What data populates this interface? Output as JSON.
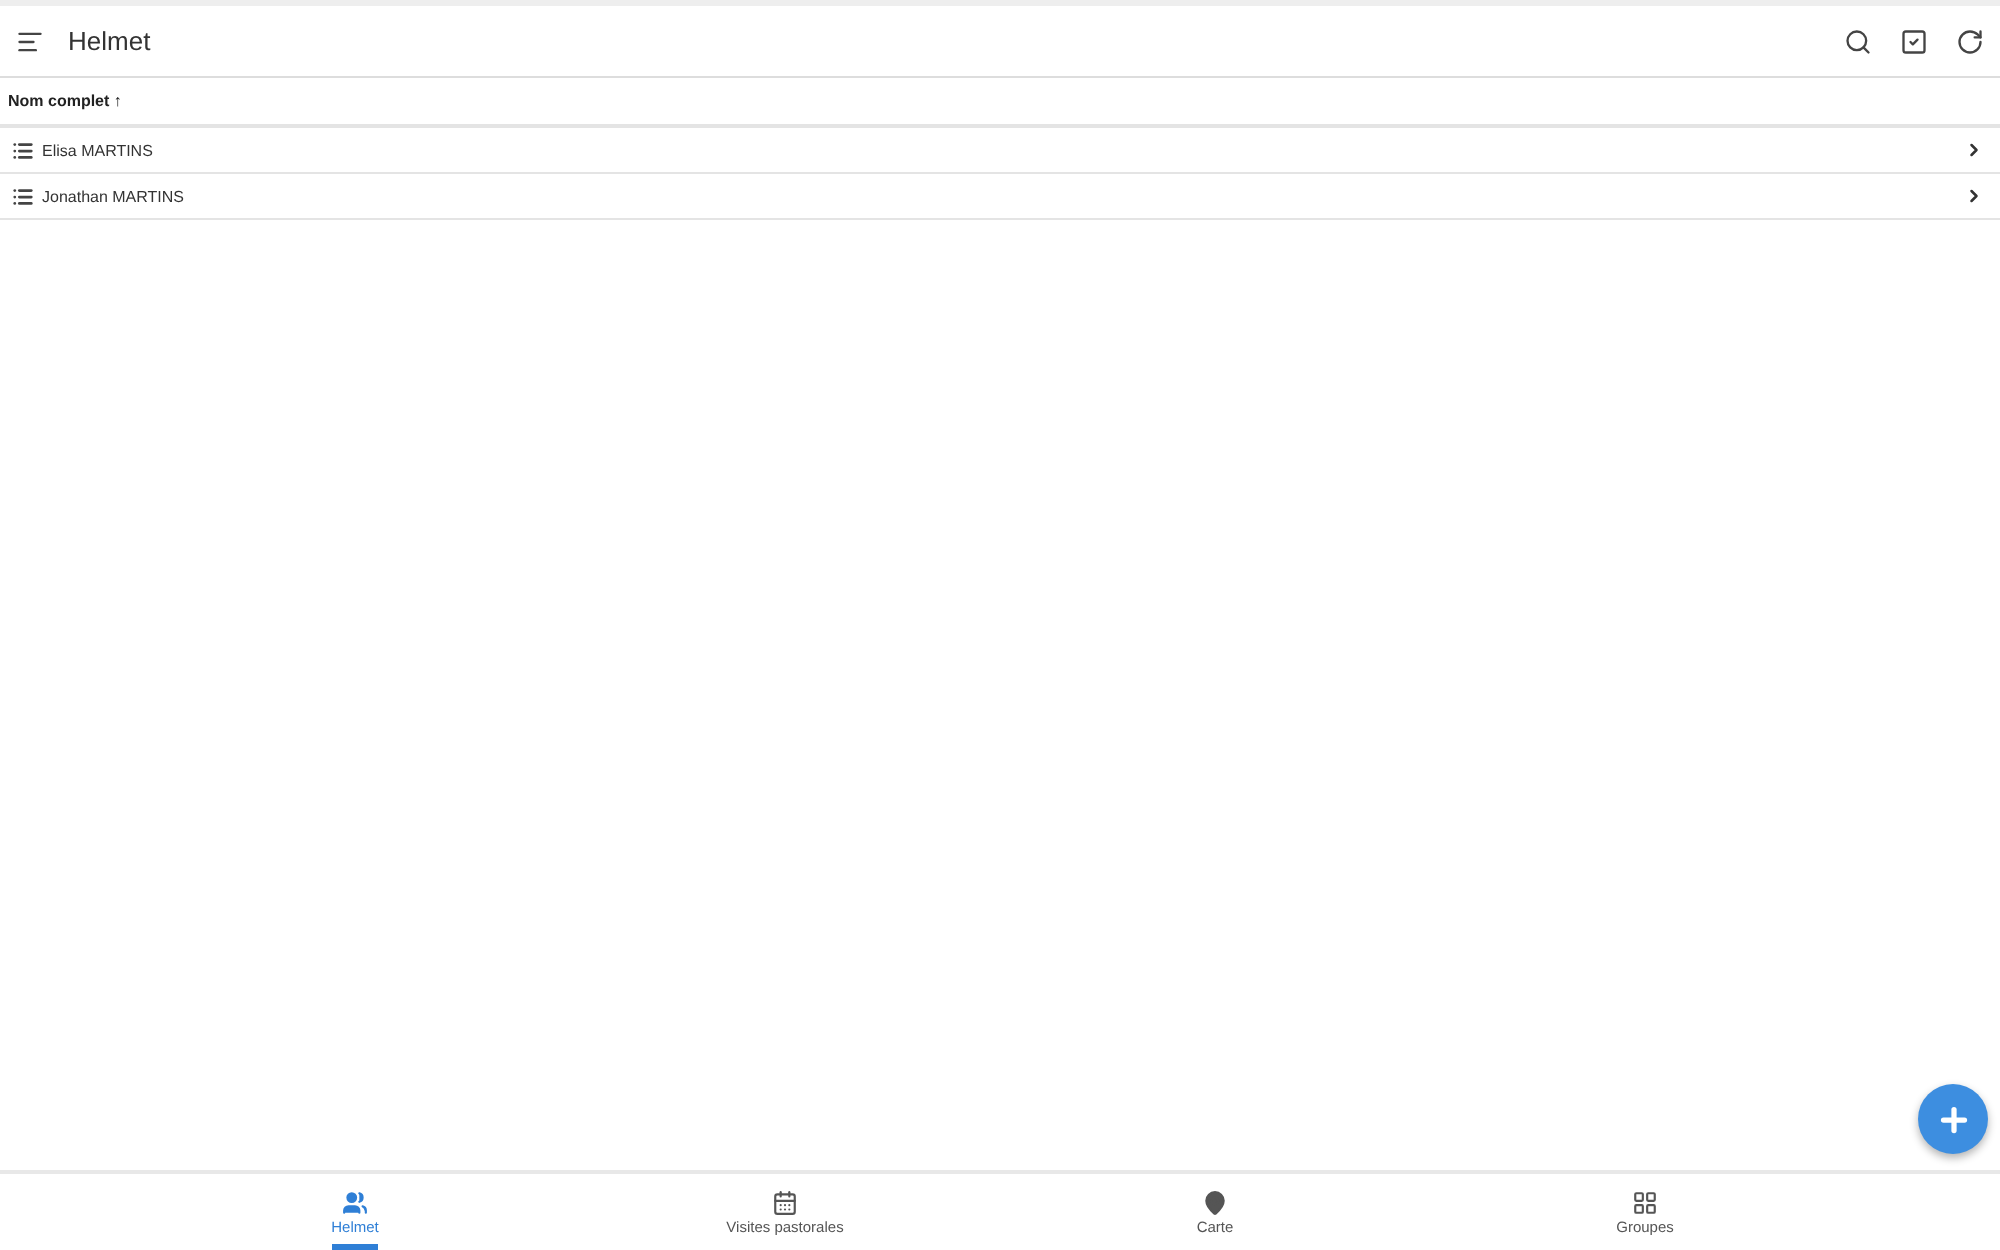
{
  "app_bar": {
    "title": "Helmet"
  },
  "table": {
    "columns": [
      {
        "label": "Nom complet",
        "sort_icon": "↑"
      }
    ],
    "rows": [
      {
        "name": "Elisa MARTINS"
      },
      {
        "name": "Jonathan MARTINS"
      }
    ]
  },
  "bottom_nav": [
    {
      "kind": "people",
      "label": "Helmet",
      "selected": true
    },
    {
      "kind": "calendar",
      "label": "Visites pastorales",
      "selected": false
    },
    {
      "kind": "pin",
      "label": "Carte",
      "selected": false
    },
    {
      "kind": "groups",
      "label": "Groupes",
      "selected": false
    }
  ]
}
